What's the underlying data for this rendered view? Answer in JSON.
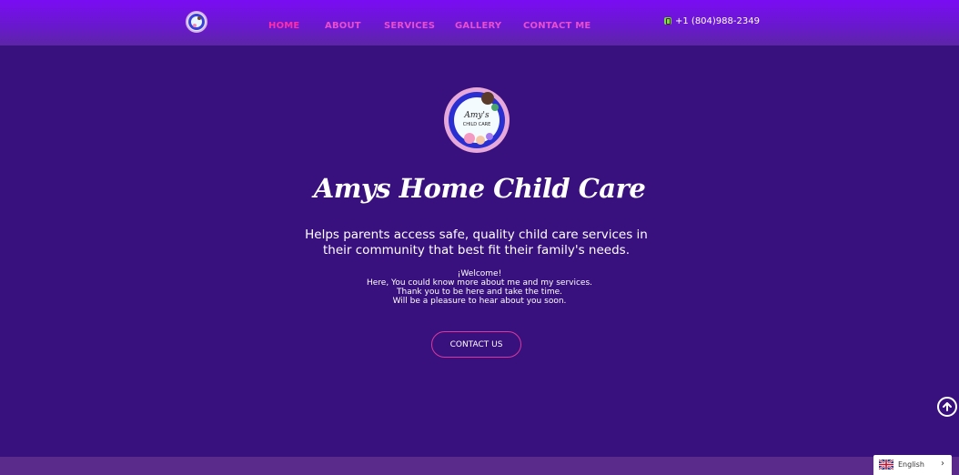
{
  "nav": {
    "items": [
      {
        "label": "HOME",
        "active": true
      },
      {
        "label": "ABOUT"
      },
      {
        "label": "SERVICES"
      },
      {
        "label": "GALLERY"
      },
      {
        "label": "CONTACT ME"
      }
    ]
  },
  "header": {
    "phone_icon": "phone-icon",
    "phone": "+1 (804)988-2349"
  },
  "hero": {
    "title": "Amys Home Child Care",
    "subtitle": "Helps parents access safe, quality child care services in their community that best fit their family's needs.",
    "welcome_lines": [
      "¡Welcome!",
      "Here, You could know more about me and my services.",
      "Thank you to be here and take the time.",
      "Will be a pleasure to hear about you soon."
    ],
    "cta_label": "CONTACT US"
  },
  "logo_text": {
    "line1": "Amy's",
    "line2": "CHILD CARE"
  },
  "language": {
    "selected": "English",
    "icon": "chevron-right-icon"
  },
  "colors": {
    "nav_link": "#e94ecf",
    "nav_active": "#ff2ea8",
    "background": "#39117e",
    "cta_border": "#d7399c"
  }
}
